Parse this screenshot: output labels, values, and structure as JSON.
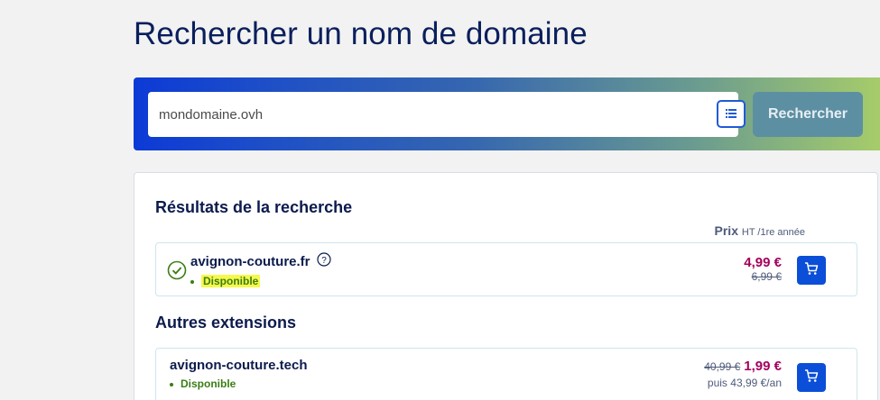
{
  "page": {
    "title": "Rechercher un nom de domaine"
  },
  "search": {
    "value": "mondomaine.ovh",
    "list_icon": "list-icon",
    "button_label": "Rechercher"
  },
  "results": {
    "title": "Résultats de la recherche",
    "price_header_label": "Prix",
    "price_header_sub": "HT /1re année",
    "main": {
      "domain": "avignon-couture.fr",
      "status": "Disponible",
      "price_new": "4,99 €",
      "price_old": "6,99 €",
      "status_icon": "check-circle-icon",
      "help_icon": "question-icon"
    },
    "other_title": "Autres extensions",
    "others": [
      {
        "domain": "avignon-couture.tech",
        "status": "Disponible",
        "price_old": "40,99 €",
        "price_new": "1,99 €",
        "renewal": "puis 43,99 €/an"
      }
    ]
  },
  "colors": {
    "accent": "#0b4ed8",
    "price": "#a3005d",
    "available": "#3b7d15",
    "highlight": "#f6f94a"
  }
}
